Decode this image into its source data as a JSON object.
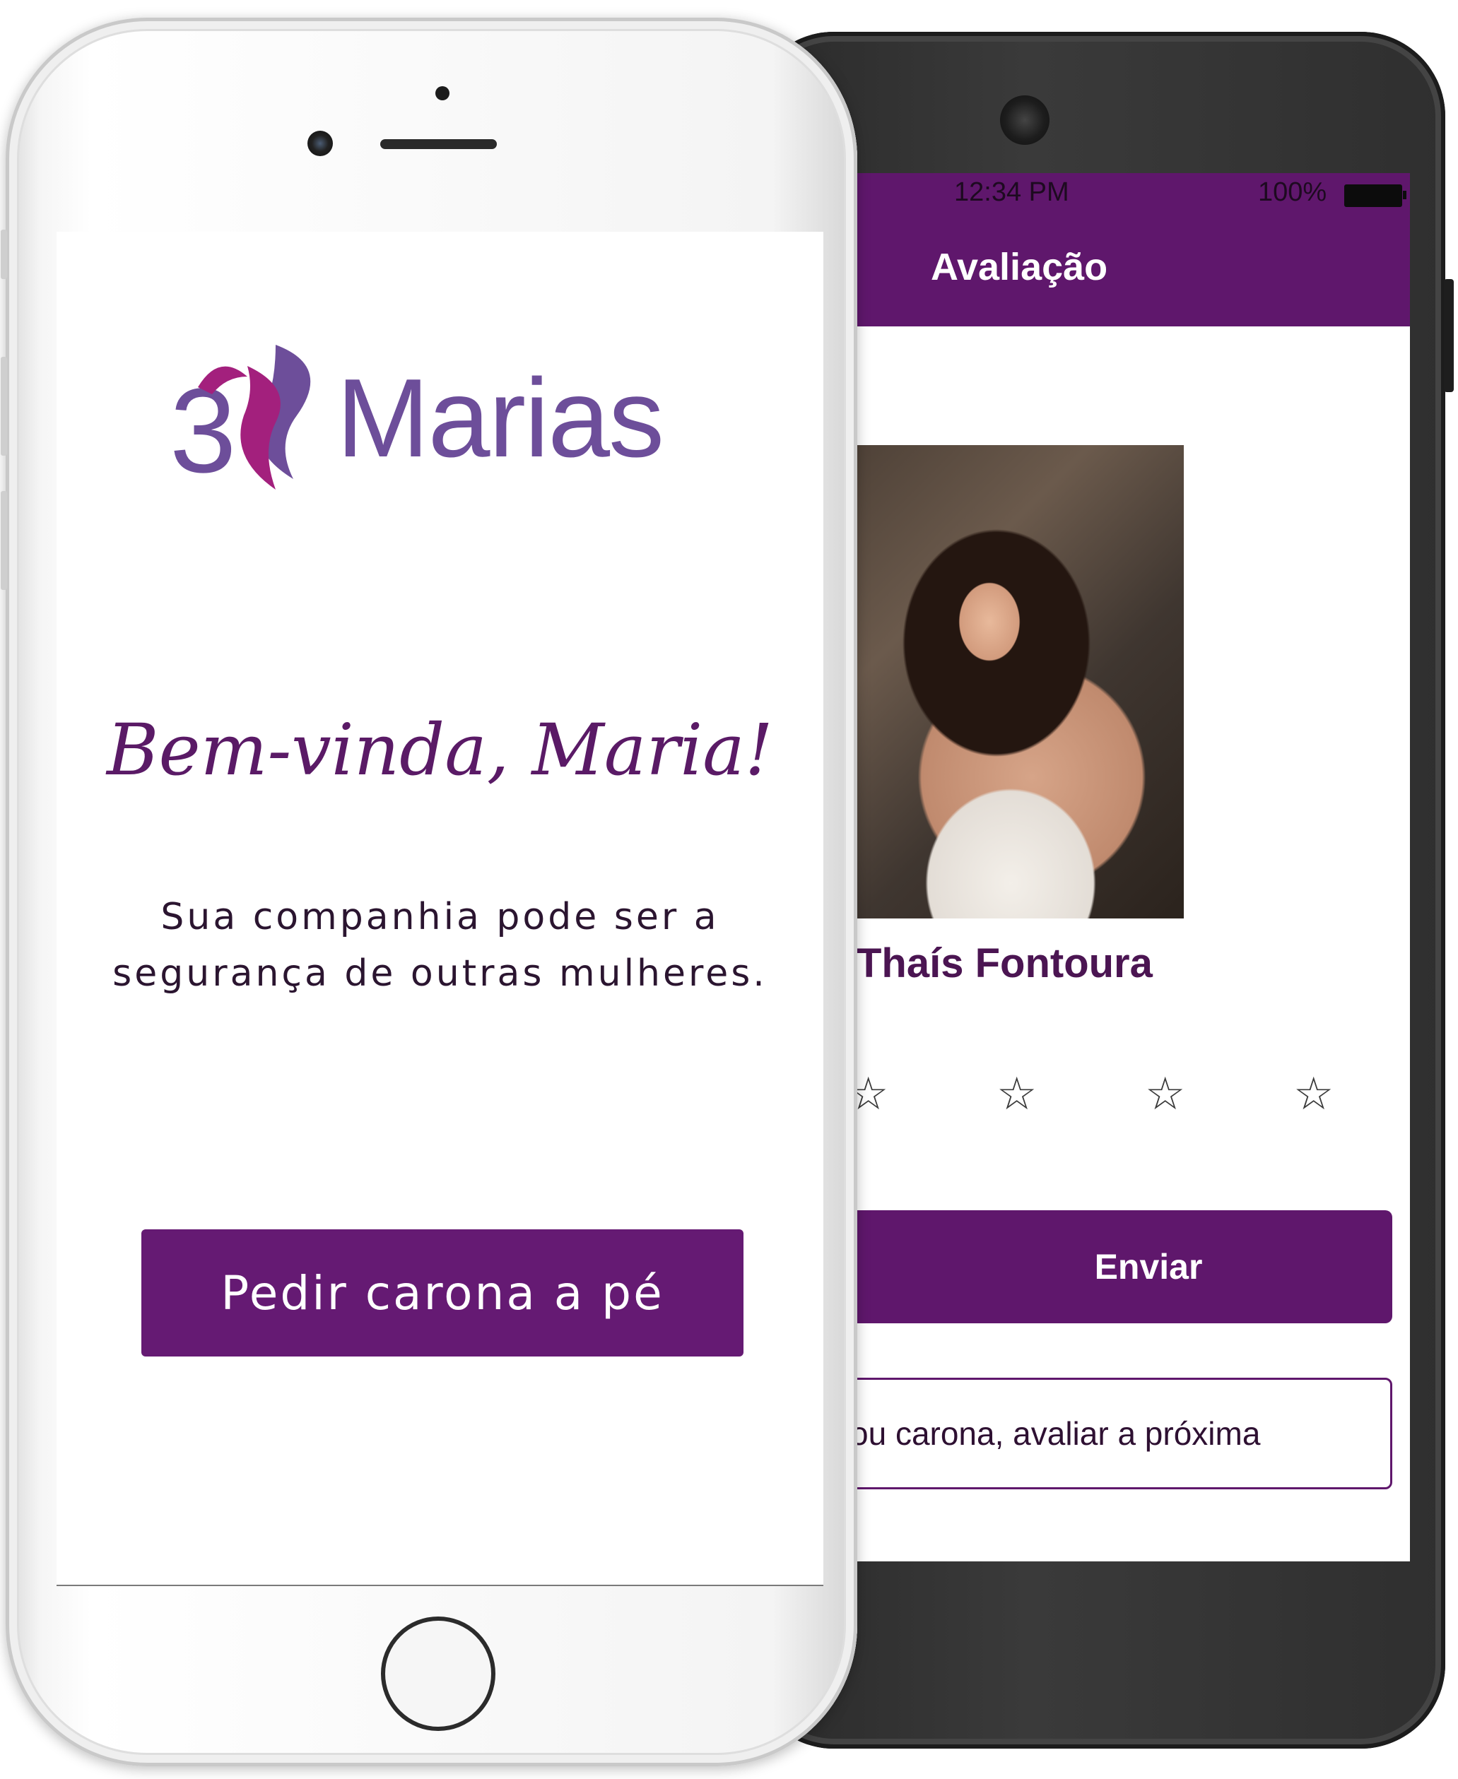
{
  "android": {
    "status": {
      "time": "12:34 PM",
      "battery": "100%"
    },
    "title": "Avaliação",
    "profile_name": "Thaís Fontoura",
    "stars": [
      "☆",
      "☆",
      "☆",
      "☆"
    ],
    "send_label": "Enviar",
    "skip_label": "ou carona, avaliar a próxima"
  },
  "iphone": {
    "logo_text": "Marias",
    "welcome": "Bem-vinda, Maria!",
    "subtitle_line1": "Sua companhia pode ser a",
    "subtitle_line2": "segurança de outras mulheres.",
    "request_label": "Pedir carona a pé"
  },
  "colors": {
    "brand_purple": "#5f176c",
    "logo_purple": "#6d4e9a",
    "logo_magenta": "#a3207d"
  }
}
